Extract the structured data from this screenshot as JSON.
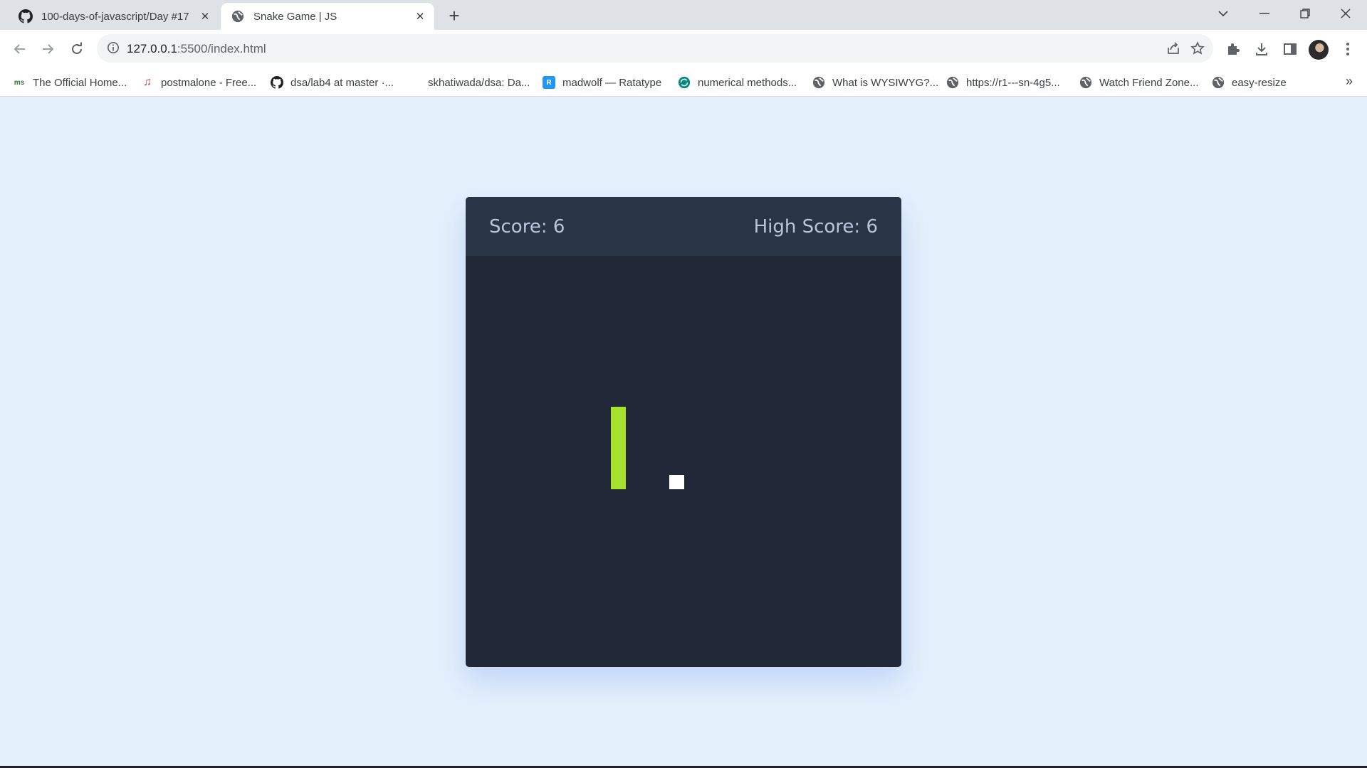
{
  "browser": {
    "tabs": [
      {
        "title": "100-days-of-javascript/Day #17",
        "favicon": "github-icon",
        "active": false
      },
      {
        "title": "Snake Game | JS",
        "favicon": "globe-icon",
        "active": true
      }
    ],
    "address": {
      "host": "127.0.0.1",
      "path": ":5500/index.html"
    },
    "bookmarks": [
      {
        "label": "The Official Home...",
        "icon": "site-icon",
        "color": "#2e7d32"
      },
      {
        "label": "postmalone - Free...",
        "icon": "music-note-icon",
        "color": "#e53935"
      },
      {
        "label": "dsa/lab4 at master ·...",
        "icon": "github-icon",
        "color": "#202124"
      },
      {
        "label": "skhatiwada/dsa: Da...",
        "icon": "blank-icon",
        "color": "#ffffff"
      },
      {
        "label": "madwolf — Ratatype",
        "icon": "ratatype-icon",
        "color": "#2196f3"
      },
      {
        "label": "numerical methods...",
        "icon": "sync-icon",
        "color": "#00897b"
      },
      {
        "label": "What is WYSIWYG?...",
        "icon": "globe-icon",
        "color": "#5f6368"
      },
      {
        "label": "https://r1---sn-4g5...",
        "icon": "globe-icon",
        "color": "#5f6368"
      },
      {
        "label": "Watch Friend Zone...",
        "icon": "globe-icon",
        "color": "#5f6368"
      },
      {
        "label": "easy-resize",
        "icon": "globe-icon",
        "color": "#5f6368"
      }
    ]
  },
  "game": {
    "score_text": "Score: 6",
    "high_score_text": "High Score: 6",
    "grid_size": 30,
    "snake": [
      [
        11,
        12
      ],
      [
        11,
        13
      ],
      [
        11,
        14
      ],
      [
        11,
        15
      ],
      [
        11,
        16
      ],
      [
        11,
        17
      ]
    ],
    "food": [
      15,
      17
    ],
    "colors": {
      "snake": "#a6e22e",
      "food": "#ffffff",
      "board": "#212837",
      "header": "#293447",
      "page": "#e3f0fc"
    }
  }
}
